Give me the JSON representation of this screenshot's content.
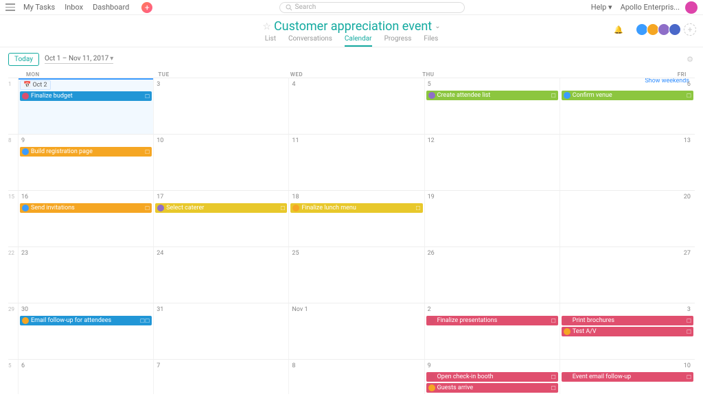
{
  "topnav": {
    "my_tasks": "My Tasks",
    "inbox": "Inbox",
    "dashboard": "Dashboard"
  },
  "search": {
    "placeholder": "Search"
  },
  "help": "Help",
  "workspace": "Apollo Enterpris...",
  "project": {
    "title": "Customer appreciation event",
    "tabs": {
      "list": "List",
      "conversations": "Conversations",
      "calendar": "Calendar",
      "progress": "Progress",
      "files": "Files"
    },
    "member_colors": [
      "#d94f6e",
      "#3b9cff",
      "#f5a623",
      "#8e6ec8",
      "#4a68c9"
    ]
  },
  "toolbar": {
    "today": "Today",
    "range": "Oct 1 – Nov 11, 2017"
  },
  "dayhead": {
    "mon": "MON",
    "tue": "TUE",
    "wed": "WED",
    "thu": "THU",
    "fri": "FRI",
    "show_weekends": "Show weekends"
  },
  "weeks": [
    {
      "no": "1",
      "days": [
        "Oct 2",
        "3",
        "4",
        "5",
        "6"
      ],
      "today_col": 0
    },
    {
      "no": "8",
      "days": [
        "9",
        "10",
        "11",
        "12",
        "13"
      ]
    },
    {
      "no": "15",
      "days": [
        "16",
        "17",
        "18",
        "19",
        "20"
      ]
    },
    {
      "no": "22",
      "days": [
        "23",
        "24",
        "25",
        "26",
        "27"
      ]
    },
    {
      "no": "29",
      "days": [
        "30",
        "31",
        "Nov 1",
        "2",
        "3"
      ]
    },
    {
      "no": "5",
      "days": [
        "6",
        "7",
        "8",
        "9",
        "10"
      ]
    }
  ],
  "tasks": {
    "finalize_budget": "Finalize budget",
    "create_attendee": "Create attendee list",
    "confirm_venue": "Confirm venue",
    "build_reg": "Build registration page",
    "send_inv": "Send invitations",
    "select_caterer": "Select caterer",
    "finalize_lunch": "Finalize lunch menu",
    "email_followup": "Email follow-up for attendees",
    "finalize_pres": "Finalize presentations",
    "print_broch": "Print brochures",
    "test_av": "Test A/V",
    "open_checkin": "Open check-in booth",
    "guests_arrive": "Guests arrive",
    "event_followup": "Event email follow-up"
  },
  "avatars": {
    "a": "#d94f6e",
    "b": "#8e6ec8",
    "c": "#f5a623",
    "d": "#3b9cff",
    "e": "#4a68c9"
  }
}
